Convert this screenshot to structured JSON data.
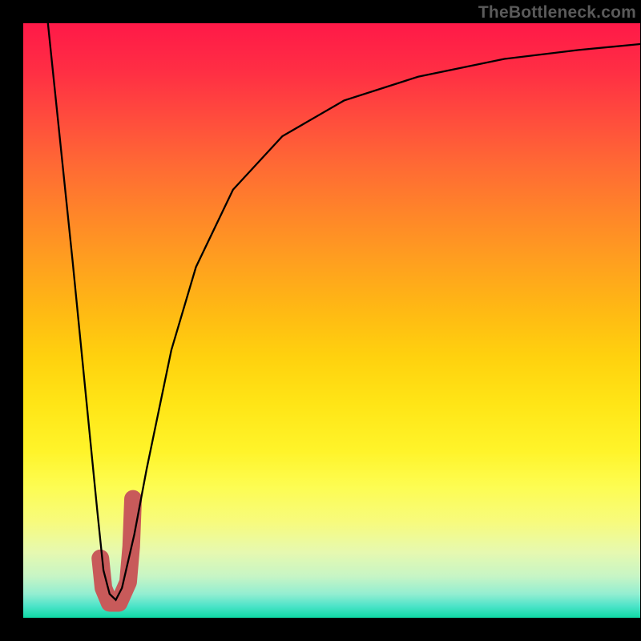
{
  "watermark": {
    "text": "TheBottleneck.com"
  },
  "accent": {
    "marker": "#c85a5a",
    "curve": "#000000"
  },
  "chart_data": {
    "type": "line",
    "title": "",
    "xlabel": "",
    "ylabel": "",
    "xlim": [
      0,
      100
    ],
    "ylim": [
      0,
      100
    ],
    "grid": false,
    "series": [
      {
        "name": "bottleneck-curve",
        "x": [
          4,
          6,
          8,
          10,
          12,
          13,
          14,
          15,
          16,
          18,
          20,
          24,
          28,
          34,
          42,
          52,
          64,
          78,
          90,
          100
        ],
        "y": [
          100,
          80,
          60,
          39,
          18,
          8,
          4,
          3,
          5,
          14,
          25,
          45,
          59,
          72,
          81,
          87,
          91,
          94,
          95.5,
          96.5
        ]
      }
    ],
    "marker": {
      "name": "highlight-j",
      "x": [
        12.5,
        13.0,
        14.0,
        15.5,
        17.0,
        17.5,
        17.8
      ],
      "y": [
        10,
        5,
        2.5,
        2.5,
        6,
        12,
        20
      ]
    }
  }
}
